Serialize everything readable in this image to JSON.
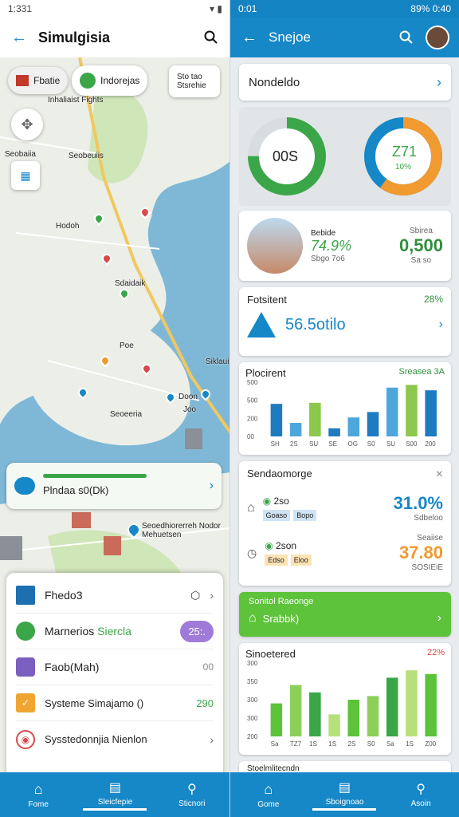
{
  "left": {
    "status_time": "1:331",
    "title": "Simulgisia",
    "chips": [
      "Fbatie",
      "Indorejas",
      "Sto tao Stsrehie"
    ],
    "map_labels": [
      "Inhaliaist Fights",
      "Seobaiia",
      "Seobeuiis",
      "Hodoh",
      "Sdaidaik",
      "Poe",
      "Siklaui",
      "Doon",
      "Joo",
      "Seoeeria",
      "Seoedhiorerreh Nodor Mehuetsen"
    ],
    "route": {
      "label": "Plndaa s0(Dk)",
      "progress": 0.62
    },
    "list": [
      {
        "label": "Fhedo3",
        "value": "",
        "icon": "square-icon",
        "color": "#1c6fb0"
      },
      {
        "label": "Marnerios",
        "accent": "Siercla",
        "value": "25:.",
        "icon": "leaf-icon",
        "color": "#3aa648"
      },
      {
        "label": "Faob(Mah)",
        "value": "00",
        "icon": "hexagon-icon",
        "color": "#7a5fc0"
      },
      {
        "label": "Systeme Simajamo ()",
        "value": "290",
        "icon": "check-icon",
        "color": "#f0a530"
      },
      {
        "label": "Sysstedonnjia Nienlon",
        "value": "",
        "icon": "target-icon",
        "color": "#d84a4a"
      }
    ],
    "nav": [
      "Fome",
      "Sleicfepie",
      "Sticnori"
    ]
  },
  "right": {
    "status_time": "0:01",
    "status_right": "89% 0:40",
    "title": "Snejoe",
    "nav_card": "Nondeldo",
    "donut1": {
      "text": "00S",
      "fraction": 0.75
    },
    "donut2": {
      "text": "Z71",
      "sub": "10%",
      "fraction": 0.6
    },
    "stat": {
      "title": "Bebide",
      "value": "74.9%",
      "sub": "Sbgo 7o6",
      "right_label": "Sbirea",
      "right_value": "0,500",
      "right_sub": "Sa so"
    },
    "ferment": {
      "title": "Fotsitent",
      "badge": "28%",
      "value": "56.5otilo"
    },
    "chart1": {
      "title": "Plocirent",
      "badge": "Sreasea 3A",
      "yticks": [
        "500",
        "500",
        "200",
        "00"
      ],
      "xticks": [
        "SH",
        "2S",
        "SU",
        "SE",
        "OG",
        "S0",
        "SU",
        "S00",
        "200"
      ]
    },
    "dual": {
      "title": "Sendaomorge",
      "v1": "31.0%",
      "s1": "Sdbeloo",
      "l1": "2so",
      "tags1": [
        "Goaso",
        "Bopo"
      ],
      "v2": "37.80",
      "l2": "2son",
      "r2": "Seaiise",
      "s2": "SOSIEiE",
      "tags2": [
        "Edso",
        "Eloo"
      ]
    },
    "green_card": {
      "title": "Sonitol Raeonge",
      "label": "Srabbk)"
    },
    "chart2": {
      "title": "Sinoetered",
      "badge": "22%",
      "yticks": [
        "300",
        "350",
        "300",
        "300",
        "200"
      ],
      "xticks": [
        "Sa",
        "TZ7",
        "1S",
        "1S",
        "2S",
        "S0",
        "Sa",
        "1S",
        "Z00"
      ]
    },
    "bottom_peek": "Stoelmlitecndn",
    "nav": [
      "Gome",
      "Sboignoao",
      "Asoin"
    ]
  },
  "chart_data": [
    {
      "type": "bar",
      "title": "Plocirent",
      "categories": [
        "SH",
        "2S",
        "SU",
        "SE",
        "OG",
        "S0",
        "SU",
        "S00",
        "200"
      ],
      "values": [
        60,
        25,
        62,
        15,
        35,
        45,
        90,
        95,
        85
      ]
    },
    {
      "type": "bar",
      "title": "Sinoetered",
      "categories": [
        "Sa",
        "TZ7",
        "1S",
        "1S",
        "2S",
        "S0",
        "Sa",
        "1S",
        "Z00"
      ],
      "values": [
        45,
        70,
        60,
        30,
        50,
        55,
        80,
        90,
        85
      ]
    }
  ],
  "colors": {
    "brand": "#1687c7",
    "green": "#3aa648",
    "orange": "#f09a30"
  }
}
